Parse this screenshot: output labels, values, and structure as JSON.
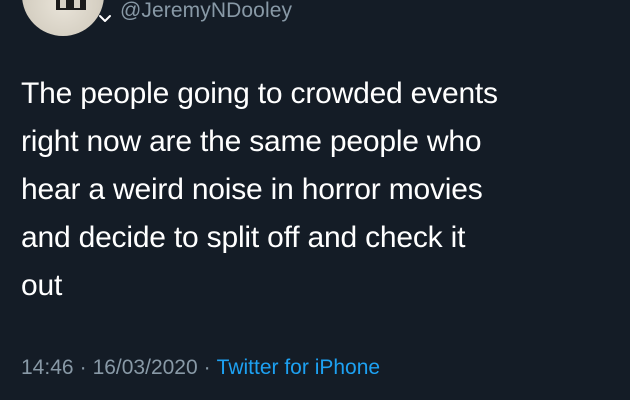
{
  "tweet": {
    "handle": "@JeremyNDooley",
    "lines": [
      "The people going to crowded events",
      "right now are the same people who",
      "hear a weird noise in horror movies",
      "and decide to split off and check it",
      "out"
    ],
    "time": "14:46",
    "date": "16/03/2020",
    "separator": "·",
    "source": "Twitter for iPhone"
  },
  "colors": {
    "background": "#141c26",
    "text": "#ffffff",
    "muted": "#8899a6",
    "link": "#1da1f2"
  },
  "icons": {
    "avatar": "avatar",
    "menu": "chevron-down-icon"
  }
}
